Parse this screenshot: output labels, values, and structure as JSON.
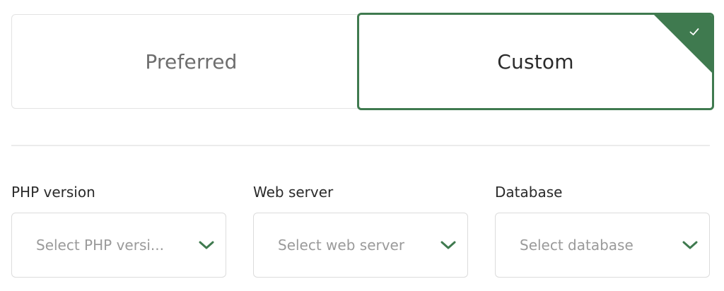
{
  "colors": {
    "accent": "#3f7a4f",
    "border": "#dcdcdc",
    "placeholder": "#9a9a9a"
  },
  "toggle": {
    "options": [
      {
        "label": "Preferred",
        "selected": false
      },
      {
        "label": "Custom",
        "selected": true
      }
    ],
    "selected_icon": "check-icon"
  },
  "fields": [
    {
      "label": "PHP version",
      "placeholder": "Select PHP versi...",
      "icon": "chevron-down-icon"
    },
    {
      "label": "Web server",
      "placeholder": "Select web server",
      "icon": "chevron-down-icon"
    },
    {
      "label": "Database",
      "placeholder": "Select database",
      "icon": "chevron-down-icon"
    }
  ]
}
